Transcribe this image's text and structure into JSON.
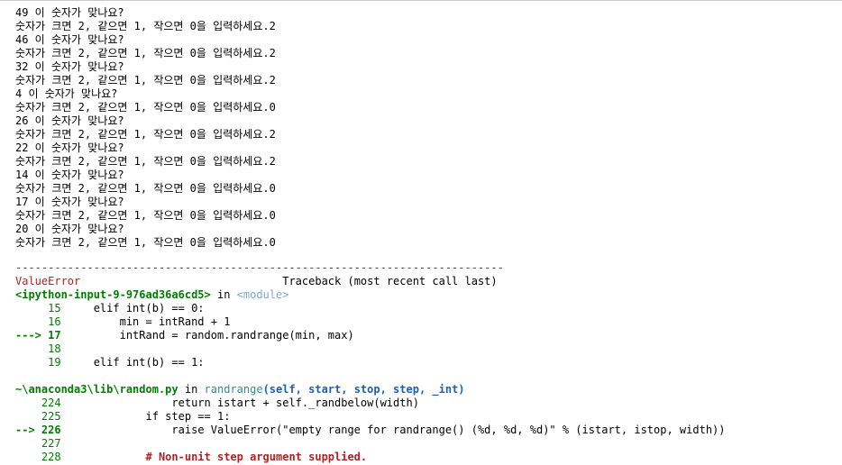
{
  "output_lines": [
    "49 이 숫자가 맞나요?",
    "숫자가 크면 2, 같으면 1, 작으면 0을 입력하세요.2",
    "46 이 숫자가 맞나요?",
    "숫자가 크면 2, 같으면 1, 작으면 0을 입력하세요.2",
    "32 이 숫자가 맞나요?",
    "숫자가 크면 2, 같으면 1, 작으면 0을 입력하세요.2",
    "4 이 숫자가 맞나요?",
    "숫자가 크면 2, 같으면 1, 작으면 0을 입력하세요.0",
    "26 이 숫자가 맞나요?",
    "숫자가 크면 2, 같으면 1, 작으면 0을 입력하세요.2",
    "22 이 숫자가 맞나요?",
    "숫자가 크면 2, 같으면 1, 작으면 0을 입력하세요.2",
    "14 이 숫자가 맞나요?",
    "숫자가 크면 2, 같으면 1, 작으면 0을 입력하세요.0",
    "17 이 숫자가 맞나요?",
    "숫자가 크면 2, 같으면 1, 작으면 0을 입력하세요.0",
    "20 이 숫자가 맞나요?",
    "숫자가 크면 2, 같으면 1, 작으면 0을 입력하세요.0"
  ],
  "traceback": {
    "separator": "---------------------------------------------------------------------------",
    "error_type": "ValueError",
    "header_gap": "                               ",
    "header_text": "Traceback (most recent call last)",
    "frame1": {
      "location": "<ipython-input-9-976ad36a6cd5>",
      "in_word": " in ",
      "func": "<module>",
      "lines": [
        {
          "gutter": "     15",
          "code": "     elif int(b) == 0:"
        },
        {
          "gutter": "     16",
          "code": "         min = intRand + 1"
        },
        {
          "gutter": "---> 17",
          "code": "         intRand = random.randrange(min, max)"
        },
        {
          "gutter": "     18",
          "code": ""
        },
        {
          "gutter": "     19",
          "code": "     elif int(b) == 1:"
        }
      ]
    },
    "frame2": {
      "location": "~\\anaconda3\\lib\\random.py",
      "in_word": " in ",
      "func": "randrange",
      "signature": "(self, start, stop, step, _int)",
      "lines": [
        {
          "gutter": "    224",
          "code": "                 return istart + self._randbelow(width)"
        },
        {
          "gutter": "    225",
          "code": "             if step == 1:"
        },
        {
          "gutter": "--> 226",
          "code": "                 raise ValueError(\"empty range for randrange() (%d, %d, %d)\" % (istart, istop, width))"
        },
        {
          "gutter": "    227",
          "code": ""
        },
        {
          "gutter": "    228",
          "code": "             # Non-unit step argument supplied."
        }
      ]
    }
  }
}
